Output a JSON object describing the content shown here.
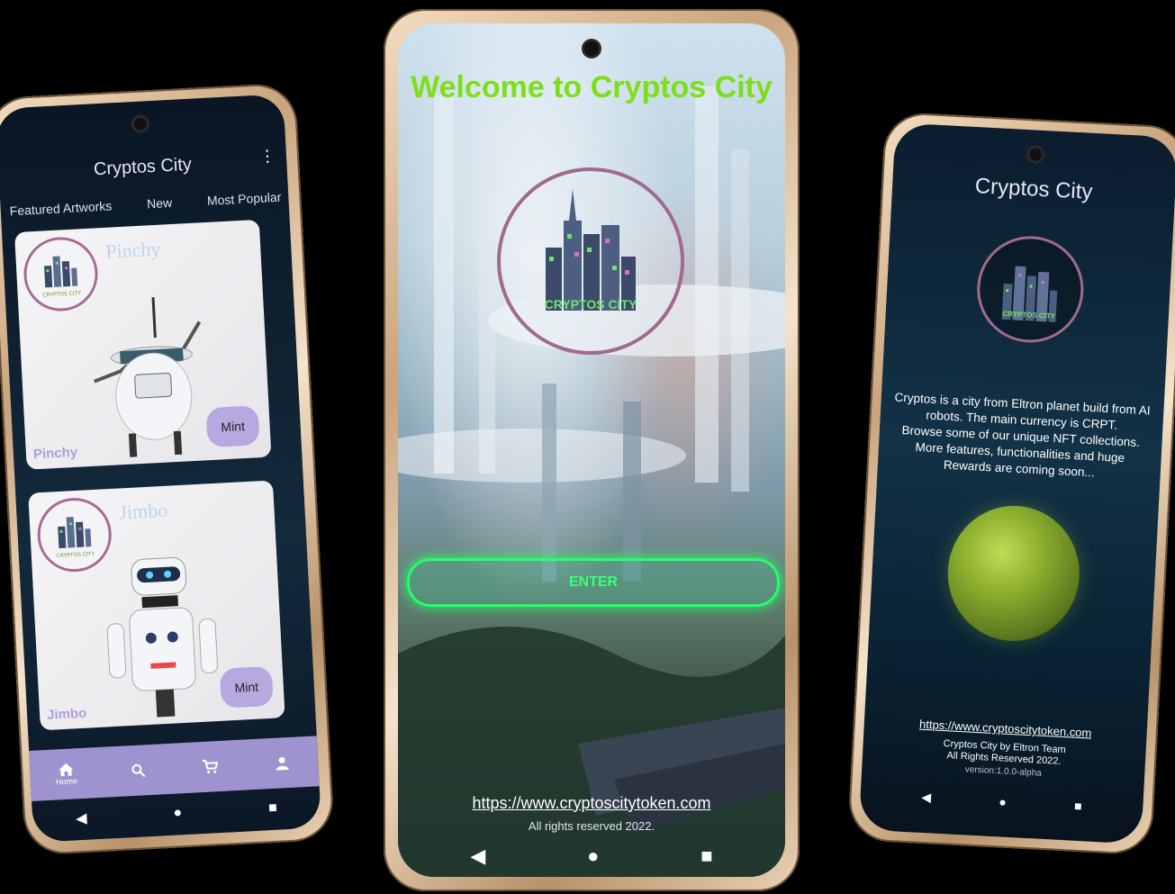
{
  "left_phone": {
    "app_title": "Cryptos City",
    "menu_icon": "more-vert-icon",
    "tabs": [
      {
        "label": "Featured Artworks"
      },
      {
        "label": "New"
      },
      {
        "label": "Most Popular"
      }
    ],
    "cards": [
      {
        "title": "Pinchy",
        "caption": "Pinchy",
        "button": "Mint"
      },
      {
        "title": "Jimbo",
        "caption": "Jimbo",
        "button": "Mint"
      }
    ],
    "bottom_nav": [
      {
        "icon": "home-icon",
        "label": "Home"
      },
      {
        "icon": "search-icon",
        "label": ""
      },
      {
        "icon": "cart-icon",
        "label": ""
      },
      {
        "icon": "person-icon",
        "label": ""
      }
    ],
    "logo_text": "CRYPTOS CITY"
  },
  "center_phone": {
    "title": "Welcome to Cryptos City",
    "logo_text": "CRYPTOS CITY",
    "enter_button": "ENTER",
    "url": "https://www.cryptoscitytoken.com",
    "rights": "All rights reserved 2022."
  },
  "right_phone": {
    "title": "Cryptos City",
    "logo_text": "CRYPTOS CITY",
    "description_lines": [
      "Cryptos is a city from Eltron planet build from AI",
      "robots. The main currency is CRPT.",
      "Browse some of our unique NFT collections.",
      "More features, functionalities and huge",
      "Rewards are coming soon..."
    ],
    "url": "https://www.cryptoscitytoken.com",
    "team": "Cryptos City by Eltron Team",
    "rights": "All Rights Reserved 2022.",
    "version": "version:1.0.0-alpha"
  },
  "colors": {
    "accent_green": "#7ede18",
    "enter_glow": "#24ff6a",
    "nav_purple": "#9f93cf",
    "logo_ring": "#a06a8f",
    "mint_button": "#b7a8e0"
  }
}
